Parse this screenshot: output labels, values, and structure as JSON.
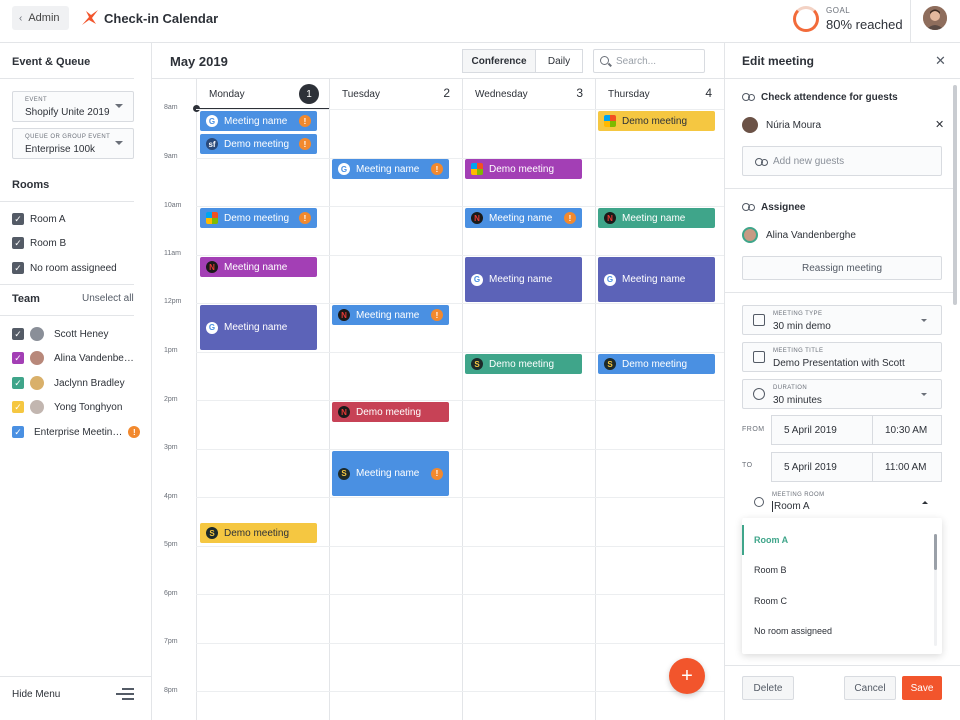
{
  "topbar": {
    "admin_label": "Admin",
    "app_title": "Check-in Calendar",
    "goal_label": "GOAL",
    "goal_value": "80% reached",
    "goal_fraction": 0.8
  },
  "sidebar": {
    "heading": "Event & Queue",
    "event_label": "EVENT",
    "event_value": "Shopify Unite 2019",
    "queue_label": "QUEUE OR GROUP EVENT",
    "queue_value": "Enterprise 100k",
    "rooms_heading": "Rooms",
    "rooms": [
      "Room A",
      "Room B",
      "No room assigneed"
    ],
    "team_heading": "Team",
    "unselect_all": "Unselect all",
    "team": [
      {
        "name": "Scott Heney",
        "color": "#545b66"
      },
      {
        "name": "Alina Vandenbe…",
        "color": "#a33fb5"
      },
      {
        "name": "Jaclynn Bradley",
        "color": "#3fa58a"
      },
      {
        "name": "Yong Tonghyon",
        "color": "#f5c741"
      },
      {
        "name": "Enterprise Meetin…",
        "color": "#4a90e2"
      }
    ],
    "hide_menu": "Hide Menu"
  },
  "calendar": {
    "month": "May 2019",
    "views": [
      "Conference",
      "Daily"
    ],
    "search_placeholder": "Search...",
    "days": [
      {
        "name": "Monday",
        "num": "1"
      },
      {
        "name": "Tuesday",
        "num": "2"
      },
      {
        "name": "Wednesday",
        "num": "3"
      },
      {
        "name": "Thursday",
        "num": "4"
      }
    ],
    "hours": [
      "8am",
      "9am",
      "10am",
      "11am",
      "12pm",
      "1pm",
      "2pm",
      "3pm",
      "4pm",
      "5pm",
      "6pm",
      "7pm",
      "8pm"
    ],
    "events": {
      "e1": "Meeting name",
      "e2": "Demo meeting",
      "e3": "Demo meeting",
      "e4": "Meeting name",
      "e5": "Meeting name",
      "e6": "Demo meeting",
      "e7": "Meeting name",
      "e8": "Meeting name",
      "e9": "Meeting name",
      "e10": "Demo meeting",
      "e11": "Demo meeting",
      "e12": "Meeting name",
      "e13": "Demo meeting",
      "e14": "Meeting name",
      "e15": "Demo meeting",
      "e16": "Meeting name",
      "e17": "Meeting name",
      "e18": "Demo meeting"
    },
    "add_button": "+"
  },
  "panel": {
    "title": "Edit meeting",
    "attendance_heading": "Check attendence for guests",
    "guest_name": "Núria Moura",
    "add_guests_placeholder": "Add new guests",
    "assignee_heading": "Assignee",
    "assignee_name": "Alina Vandenberghe",
    "reassign_button": "Reassign meeting",
    "meeting_type_label": "MEETING TYPE",
    "meeting_type_value": "30 min demo",
    "meeting_title_label": "MEETING TITLE",
    "meeting_title_value": "Demo Presentation with Scott",
    "duration_label": "DURATION",
    "duration_value": "30 minutes",
    "from_label": "FROM",
    "from_date": "5 April 2019",
    "from_time": "10:30 AM",
    "to_label": "TO",
    "to_date": "5 April 2019",
    "to_time": "11:00 AM",
    "room_label": "MEETING ROOM",
    "room_value": "Room A",
    "room_options": [
      "Room A",
      "Room B",
      "Room C",
      "No room assigneed"
    ],
    "delete_button": "Delete",
    "cancel_button": "Cancel",
    "save_button": "Save"
  }
}
